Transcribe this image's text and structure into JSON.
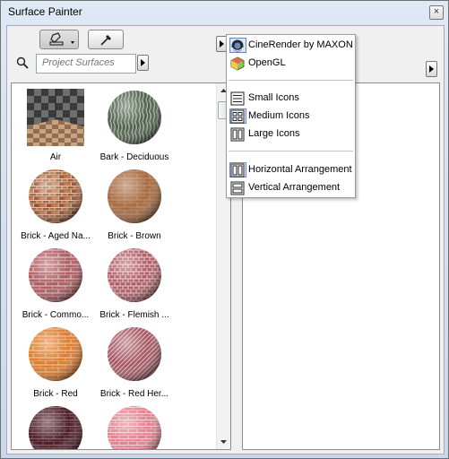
{
  "window": {
    "title": "Surface Painter",
    "close_glyph": "×"
  },
  "toolbar": {
    "paint_tool": {
      "icon": "paint-bucket-icon",
      "active": true
    },
    "eyedropper_tool": {
      "icon": "eyedropper-icon"
    }
  },
  "search": {
    "placeholder": "Project Surfaces",
    "value": ""
  },
  "surfaces": [
    {
      "label": "Air",
      "swatch": "air"
    },
    {
      "label": "Bark - Deciduous",
      "swatch": "bark"
    },
    {
      "label": "Brick - Aged Na...",
      "swatch": "brick-aged"
    },
    {
      "label": "Brick - Brown",
      "swatch": "brick-brown"
    },
    {
      "label": "Brick - Commo...",
      "swatch": "brick-common"
    },
    {
      "label": "Brick - Flemish ...",
      "swatch": "brick-flemish"
    },
    {
      "label": "Brick - Red",
      "swatch": "brick-red"
    },
    {
      "label": "Brick - Red Her...",
      "swatch": "brick-herringbone"
    },
    {
      "label": "",
      "swatch": "brick-dark"
    },
    {
      "label": "",
      "swatch": "brick-pink"
    }
  ],
  "menu": {
    "render_engines": [
      {
        "label": "CineRender by MAXON",
        "icon": "cinerender-icon",
        "checked": true
      },
      {
        "label": "OpenGL",
        "icon": "opengl-icon",
        "checked": false
      }
    ],
    "icon_sizes": [
      {
        "label": "Small Icons",
        "icon": "small-icons-icon",
        "checked": false
      },
      {
        "label": "Medium Icons",
        "icon": "medium-icons-icon",
        "checked": true
      },
      {
        "label": "Large Icons",
        "icon": "large-icons-icon",
        "checked": false
      }
    ],
    "arrangements": [
      {
        "label": "Horizontal Arrangement",
        "icon": "horizontal-arrangement-icon",
        "checked": true
      },
      {
        "label": "Vertical Arrangement",
        "icon": "vertical-arrangement-icon",
        "checked": false
      }
    ]
  },
  "colors": {
    "selection": "#d8e6f6",
    "frame": "#c9d8ea"
  }
}
